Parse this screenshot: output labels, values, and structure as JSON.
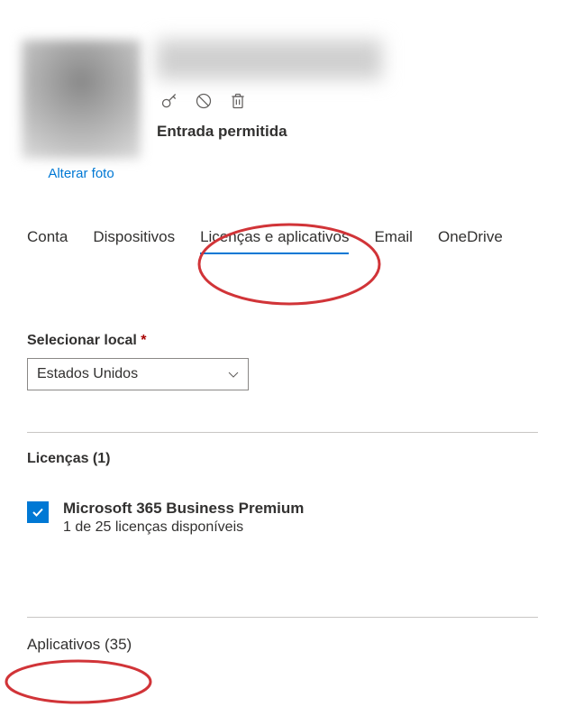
{
  "header": {
    "change_photo": "Alterar foto",
    "status": "Entrada permitida"
  },
  "tabs": {
    "account": "Conta",
    "devices": "Dispositivos",
    "licenses": "Licenças e aplicativos",
    "email": "Email",
    "onedrive": "OneDrive"
  },
  "location": {
    "label": "Selecionar local",
    "required": "*",
    "value": "Estados Unidos"
  },
  "licenses_section": {
    "title": "Licenças (1)"
  },
  "license": {
    "name": "Microsoft 365 Business Premium",
    "available": "1 de 25 licenças disponíveis"
  },
  "apps_section": {
    "title": "Aplicativos (35)"
  }
}
